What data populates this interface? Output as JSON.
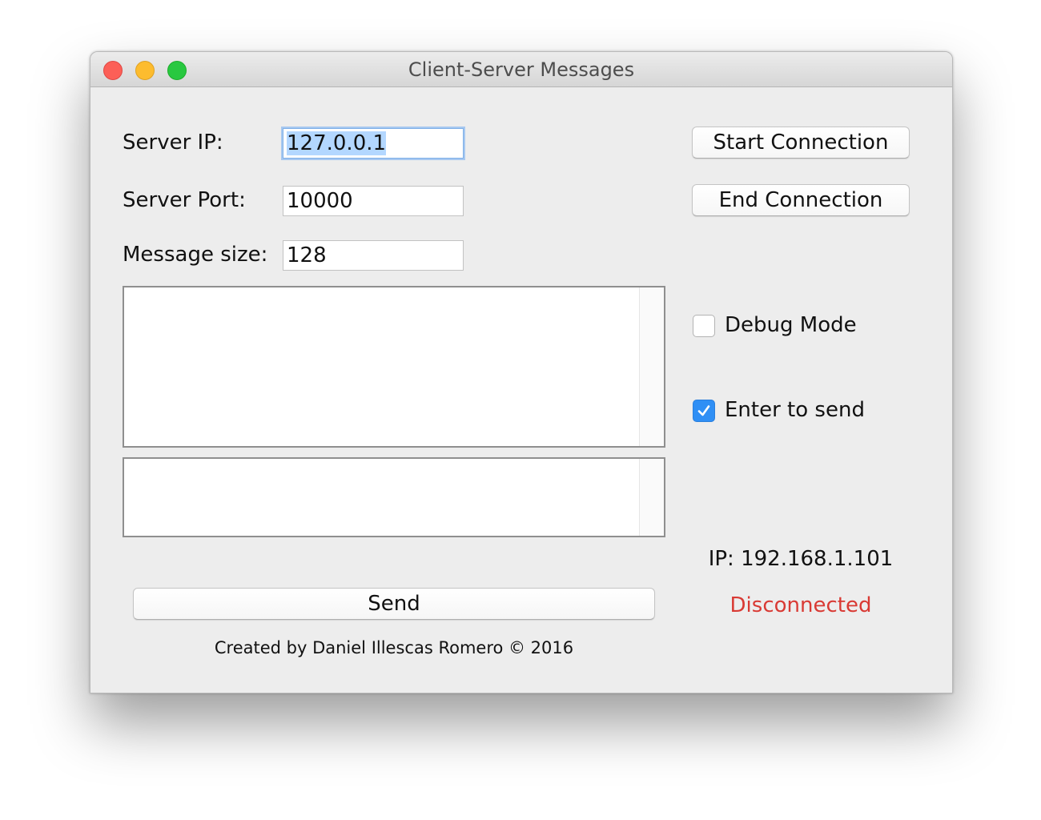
{
  "window": {
    "title": "Client-Server Messages"
  },
  "form": {
    "server_ip_label": "Server IP:",
    "server_ip_value": "127.0.0.1",
    "server_port_label": "Server Port:",
    "server_port_value": "10000",
    "message_size_label": "Message size:",
    "message_size_value": "128"
  },
  "buttons": {
    "start_connection": "Start Connection",
    "end_connection": "End Connection",
    "send": "Send"
  },
  "options": {
    "debug_mode_label": "Debug Mode",
    "debug_mode_checked": false,
    "enter_to_send_label": "Enter to send",
    "enter_to_send_checked": true
  },
  "status": {
    "ip_text": "IP: 192.168.1.101",
    "connection_text": "Disconnected",
    "connection_color": "#d93a34"
  },
  "footer": {
    "credit": "Created by Daniel Illescas Romero © 2016"
  },
  "colors": {
    "close": "#fc5f57",
    "minimize": "#fdbc2e",
    "maximize": "#28c840",
    "checkbox_accent": "#2f8ff5",
    "selection": "#b3d7ff"
  }
}
